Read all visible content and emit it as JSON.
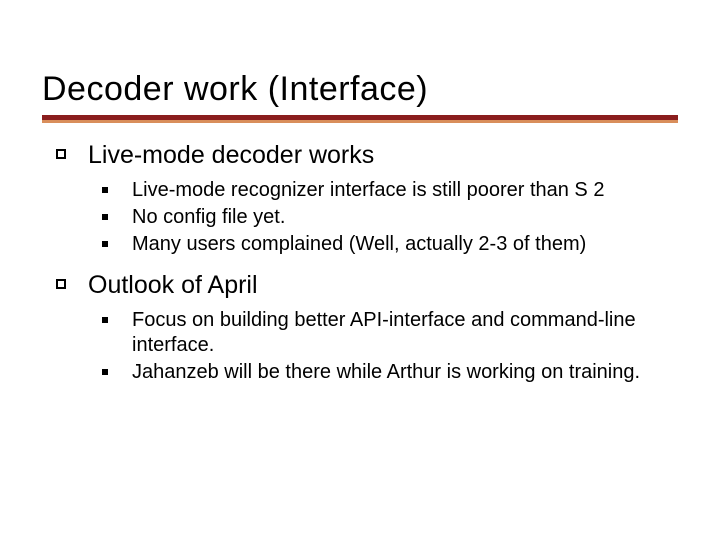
{
  "title": "Decoder work (Interface)",
  "sections": [
    {
      "heading": "Live-mode decoder works",
      "items": [
        "Live-mode recognizer interface is still poorer than S 2",
        "No config file yet.",
        "Many users complained (Well, actually 2-3 of them)"
      ]
    },
    {
      "heading": "Outlook of April",
      "items": [
        "Focus on building better API-interface and command-line interface.",
        "Jahanzeb will be there while Arthur is working on training."
      ]
    }
  ]
}
